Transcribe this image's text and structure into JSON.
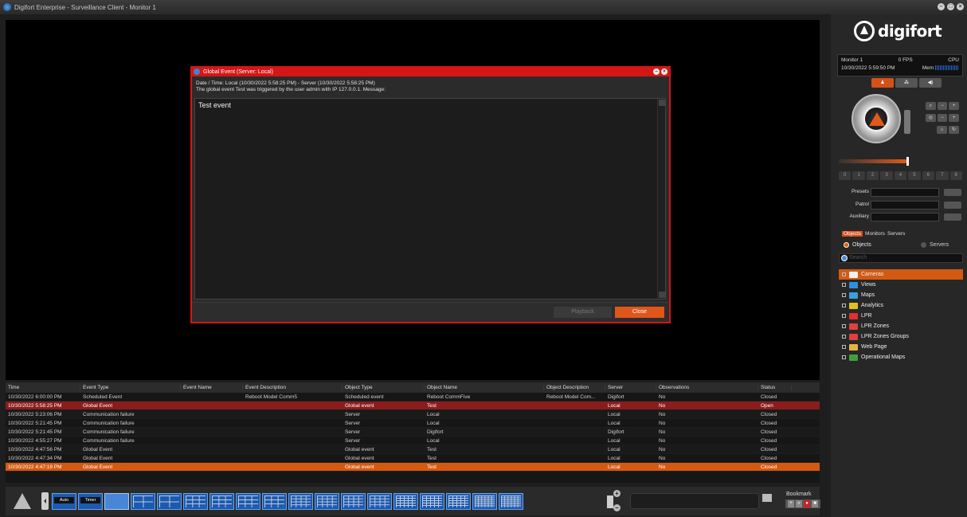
{
  "window": {
    "title": "Digifort Enterprise - Surveillance Client - Monitor 1"
  },
  "dialog": {
    "title": "Global Event (Server: Local)",
    "datetime_line": "Date / Time: Local (10/30/2022 5:58:25 PM) - Server (10/30/2022 5:58:25 PM)",
    "trigger_line": "The global event Test was triggered by the user admin with IP 127.0.0.1. Message:",
    "message": "Test event",
    "playback_label": "Playback",
    "close_label": "Close"
  },
  "events": {
    "columns": [
      "Time",
      "Event Type",
      "Event Name",
      "Event Description",
      "Object Type",
      "Object Name",
      "Object Description",
      "Server",
      "Observations",
      "Status"
    ],
    "rows": [
      [
        "10/30/2022 6:00:00 PM",
        "Scheduled Event",
        "",
        "Reboot Model Comm5",
        "Scheduled event",
        "Reboot CommFive",
        "Reboot Model Com...",
        "Digifort",
        "No",
        "Closed"
      ],
      [
        "10/30/2022 5:58:25 PM",
        "Global Event",
        "",
        "",
        "Global event",
        "Test",
        "",
        "Local",
        "No",
        "Open"
      ],
      [
        "10/30/2022 5:23:06 PM",
        "Communication failure",
        "",
        "",
        "Server",
        "Local",
        "",
        "Local",
        "No",
        "Closed"
      ],
      [
        "10/30/2022 5:21:45 PM",
        "Communication failure",
        "",
        "",
        "Server",
        "Local",
        "",
        "Local",
        "No",
        "Closed"
      ],
      [
        "10/30/2022 5:21:45 PM",
        "Communication failure",
        "",
        "",
        "Server",
        "Digifort",
        "",
        "Digifort",
        "No",
        "Closed"
      ],
      [
        "10/30/2022 4:55:27 PM",
        "Communication failure",
        "",
        "",
        "Server",
        "Local",
        "",
        "Local",
        "No",
        "Closed"
      ],
      [
        "10/30/2022 4:47:56 PM",
        "Global Event",
        "",
        "",
        "Global event",
        "Test",
        "",
        "Local",
        "No",
        "Closed"
      ],
      [
        "10/30/2022 4:47:34 PM",
        "Global Event",
        "",
        "",
        "Global event",
        "Test",
        "",
        "Local",
        "No",
        "Closed"
      ],
      [
        "10/30/2022 4:47:19 PM",
        "Global Event",
        "",
        "",
        "Global event",
        "Test",
        "",
        "Local",
        "No",
        "Closed"
      ]
    ],
    "row_styles": [
      "",
      "sel-red",
      "alt",
      "",
      "alt",
      "",
      "alt",
      "",
      "sel-orange"
    ]
  },
  "bottombar": {
    "auto_label": "Auto",
    "timer_label": "Timer",
    "bookmark_label": "Bookmark"
  },
  "panel": {
    "logo_text": "digifort",
    "monitor_label": "Monitor 1",
    "fps": "0 FPS",
    "cpu_label": "CPU",
    "datetime": "10/30/2022 5:59:50 PM",
    "mem_label": "Mem",
    "ptz_numbers": [
      "0",
      "1",
      "2",
      "3",
      "4",
      "5",
      "6",
      "7",
      "8"
    ],
    "presets_label": "Presets",
    "patrol_label": "Patrol",
    "auxiliary_label": "Auxiliary",
    "tabs": [
      "Objects",
      "Monitors",
      "Servers"
    ],
    "radio_objects": "Objects",
    "radio_servers": "Servers",
    "search_placeholder": "Search",
    "tree": [
      {
        "label": "Cameras",
        "icon": "camera-icon",
        "color": "#f0f0f0"
      },
      {
        "label": "Views",
        "icon": "views-icon",
        "color": "#2f8fe0"
      },
      {
        "label": "Maps",
        "icon": "globe-icon",
        "color": "#3aa0e0"
      },
      {
        "label": "Analytics",
        "icon": "analytics-icon",
        "color": "#e0c020"
      },
      {
        "label": "LPR",
        "icon": "car-icon",
        "color": "#e03030"
      },
      {
        "label": "LPR Zones",
        "icon": "lpr-zone-icon",
        "color": "#e04040"
      },
      {
        "label": "LPR Zones Groups",
        "icon": "lpr-zone-group-icon",
        "color": "#e04040"
      },
      {
        "label": "Web Page",
        "icon": "web-page-icon",
        "color": "#e8b040"
      },
      {
        "label": "Operational Maps",
        "icon": "operational-map-icon",
        "color": "#40a040"
      }
    ]
  },
  "colors": {
    "accent": "#d35a12",
    "alert": "#d41616"
  }
}
